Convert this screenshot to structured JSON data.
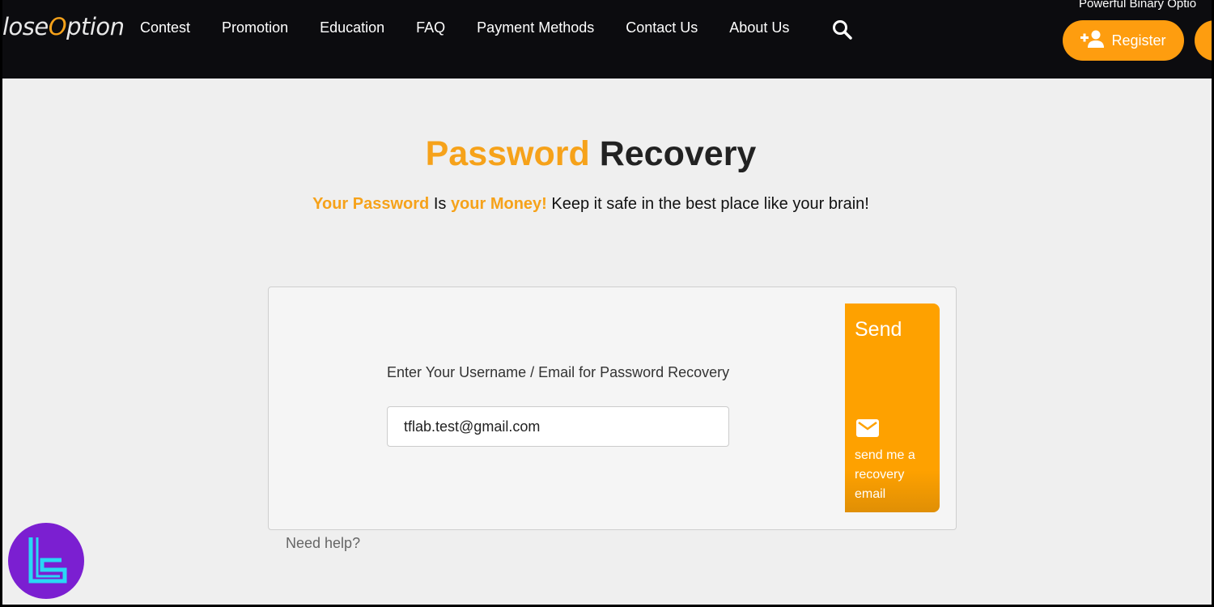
{
  "header": {
    "logo_prefix": "lose",
    "logo_accent": "O",
    "logo_suffix": "ption",
    "menu": [
      "Contest",
      "Promotion",
      "Education",
      "FAQ",
      "Payment Methods",
      "Contact Us",
      "About Us"
    ],
    "tagline": "Powerful Binary Optio",
    "register_label": "Register"
  },
  "page": {
    "title_accent": "Password",
    "title_rest": "Recovery",
    "subtitle": {
      "part1": "Your Password",
      "part2": " Is ",
      "part3": "your Money!",
      "part4": " Keep it safe in the best place like your brain!"
    }
  },
  "form": {
    "label": "Enter Your Username / Email for Password Recovery",
    "value": "tflab.test@gmail.com",
    "send_title": "Send",
    "send_desc": "send me a recovery email",
    "help_link": "Need help?"
  },
  "colors": {
    "accent": "#fea100",
    "nav_bg": "#0c0c0f"
  }
}
